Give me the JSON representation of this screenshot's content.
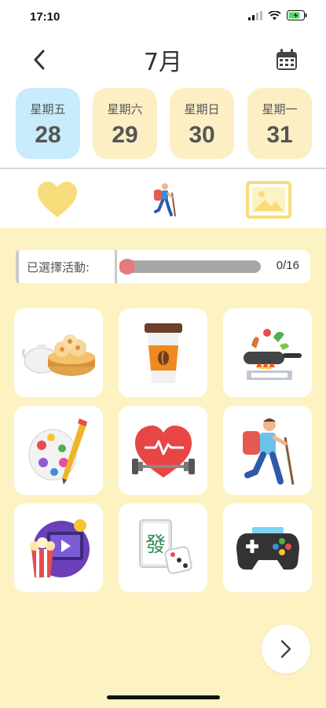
{
  "status_bar": {
    "time": "17:10"
  },
  "header": {
    "title": "7月"
  },
  "days": [
    {
      "weekday": "星期五",
      "date": "28",
      "selected": true
    },
    {
      "weekday": "星期六",
      "date": "29",
      "selected": false
    },
    {
      "weekday": "星期日",
      "date": "30",
      "selected": false
    },
    {
      "weekday": "星期一",
      "date": "31",
      "selected": false
    }
  ],
  "tabs": [
    {
      "icon": "heart-icon"
    },
    {
      "icon": "hiker-icon"
    },
    {
      "icon": "image-icon"
    }
  ],
  "selection": {
    "label": "已選擇活動:",
    "count": "0/16",
    "progress": 0
  },
  "activities": [
    {
      "icon": "dim-sum-icon"
    },
    {
      "icon": "coffee-cup-icon"
    },
    {
      "icon": "cooking-pan-icon"
    },
    {
      "icon": "paint-palette-icon"
    },
    {
      "icon": "fitness-heart-icon"
    },
    {
      "icon": "hiking-icon"
    },
    {
      "icon": "movie-popcorn-icon"
    },
    {
      "icon": "mahjong-dice-icon"
    },
    {
      "icon": "game-controller-icon"
    }
  ],
  "colors": {
    "content_bg": "#fdf3c2",
    "selected_day": "#c8ecfb",
    "day_card": "#fcefc4",
    "tab_accent": "#f7dc7a",
    "progress_fill": "#e57a7a"
  }
}
